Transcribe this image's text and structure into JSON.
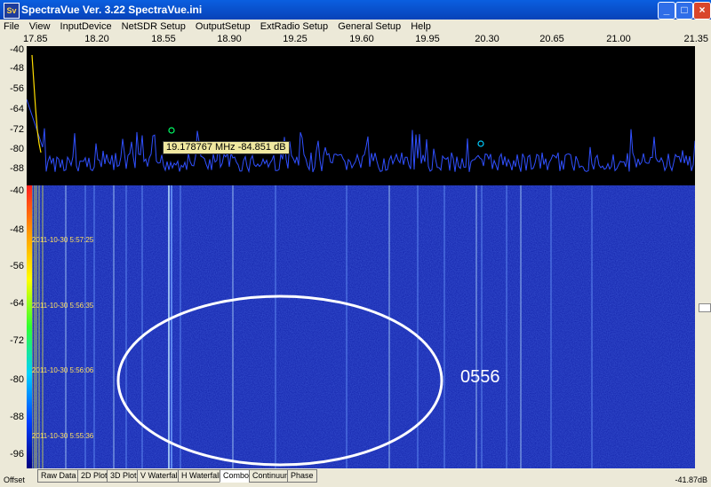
{
  "window": {
    "title": "SpectraVue Ver. 3.22 SpectraVue.ini",
    "app_icon": "Sv"
  },
  "menu": [
    "File",
    "View",
    "InputDevice",
    "NetSDR Setup",
    "OutputSetup",
    "ExtRadio Setup",
    "General Setup",
    "Help"
  ],
  "freq_axis": [
    "17.85",
    "18.20",
    "18.55",
    "18.90",
    "19.25",
    "19.60",
    "19.95",
    "20.30",
    "20.65",
    "21.00",
    "21.35"
  ],
  "spectrum_axis": [
    "-40",
    "-48",
    "-56",
    "-64",
    "-72",
    "-80",
    "-88"
  ],
  "waterfall_axis": [
    "-40",
    "-48",
    "-56",
    "-64",
    "-72",
    "-80",
    "-88",
    "-96"
  ],
  "tooltip": "19.178767 MHz  -84.851 dB",
  "waterfall_times": [
    "2011-10-30 5:57:25",
    "2011-10-30 5:56:35",
    "2011-10-30 5:56:06",
    "2011-10-30 5:55:36"
  ],
  "annotation": "0556",
  "tabs": [
    "Raw Data",
    "2D Plot",
    "3D Plot",
    "V Waterfall",
    "H Waterfall",
    "Combo",
    "Continuum",
    "Phase"
  ],
  "active_tab": "Combo",
  "offset_label": "Offset",
  "db_readout": "-41.87dB",
  "colors": {
    "spectrum_trace": "#3050ff",
    "waterfall_bg": "#1020a8",
    "annotation": "#ffffff",
    "tooltip_bg": "#f0e8a0"
  }
}
